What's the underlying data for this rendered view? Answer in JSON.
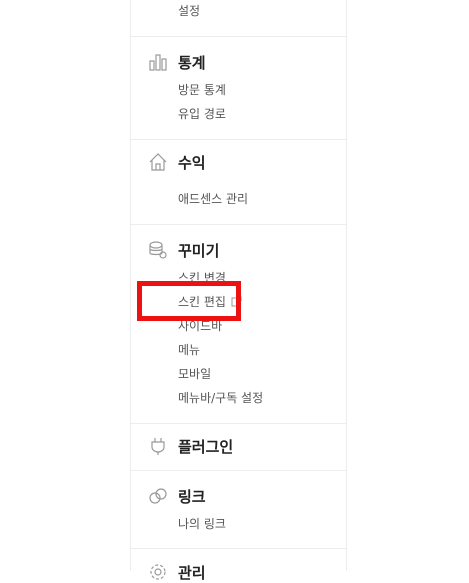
{
  "menu": {
    "top_item": "설정",
    "stats": {
      "title": "통계",
      "items": [
        "방문 통계",
        "유입 경로"
      ]
    },
    "revenue": {
      "title": "수익",
      "items": [
        "애드센스 관리"
      ]
    },
    "decorate": {
      "title": "꾸미기",
      "items": [
        "스킨 변경",
        "스킨 편집",
        "사이드바",
        "메뉴",
        "모바일",
        "메뉴바/구독 설정"
      ]
    },
    "plugin": {
      "title": "플러그인"
    },
    "link": {
      "title": "링크",
      "items": [
        "나의 링크"
      ]
    },
    "manage": {
      "title": "관리"
    }
  },
  "colors": {
    "highlight": "#ee1111",
    "divider": "#ededed",
    "icon": "#999999"
  }
}
